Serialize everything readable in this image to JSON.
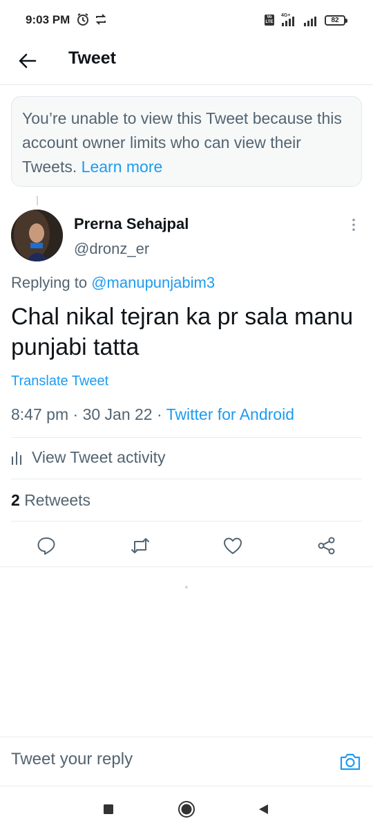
{
  "status_bar": {
    "time": "9:03 PM",
    "network_type": "4G+",
    "volte_label": "Vo LTE",
    "battery": "82"
  },
  "header": {
    "title": "Tweet",
    "back_icon": "arrow-left-icon"
  },
  "notice": {
    "text": "You’re unable to view this Tweet because this account owner limits who can view their Tweets.",
    "link": "Learn more"
  },
  "tweet": {
    "author_name": "Prerna Sehajpal",
    "author_handle": "@dronz_er",
    "replying_prefix": "Replying to",
    "replying_to": "@manupunjabim3",
    "text": "Chal nikal tejran ka pr sala manu punjabi tatta",
    "translate_label": "Translate Tweet",
    "time": "8:47 pm",
    "date": "30 Jan 22",
    "source": "Twitter for Android",
    "separator": " · ",
    "activity_label": "View Tweet activity",
    "retweets_count": "2",
    "retweets_label": "Retweets"
  },
  "actions": {
    "reply_icon": "reply-icon",
    "retweet_icon": "retweet-icon",
    "like_icon": "heart-icon",
    "share_icon": "share-icon"
  },
  "reply_bar": {
    "placeholder": "Tweet your reply",
    "camera_icon": "camera-icon"
  },
  "colors": {
    "accent": "#1d9bf0",
    "secondary_text": "#536471",
    "primary_text": "#0f1419",
    "notice_bg": "#f7f9f9"
  }
}
